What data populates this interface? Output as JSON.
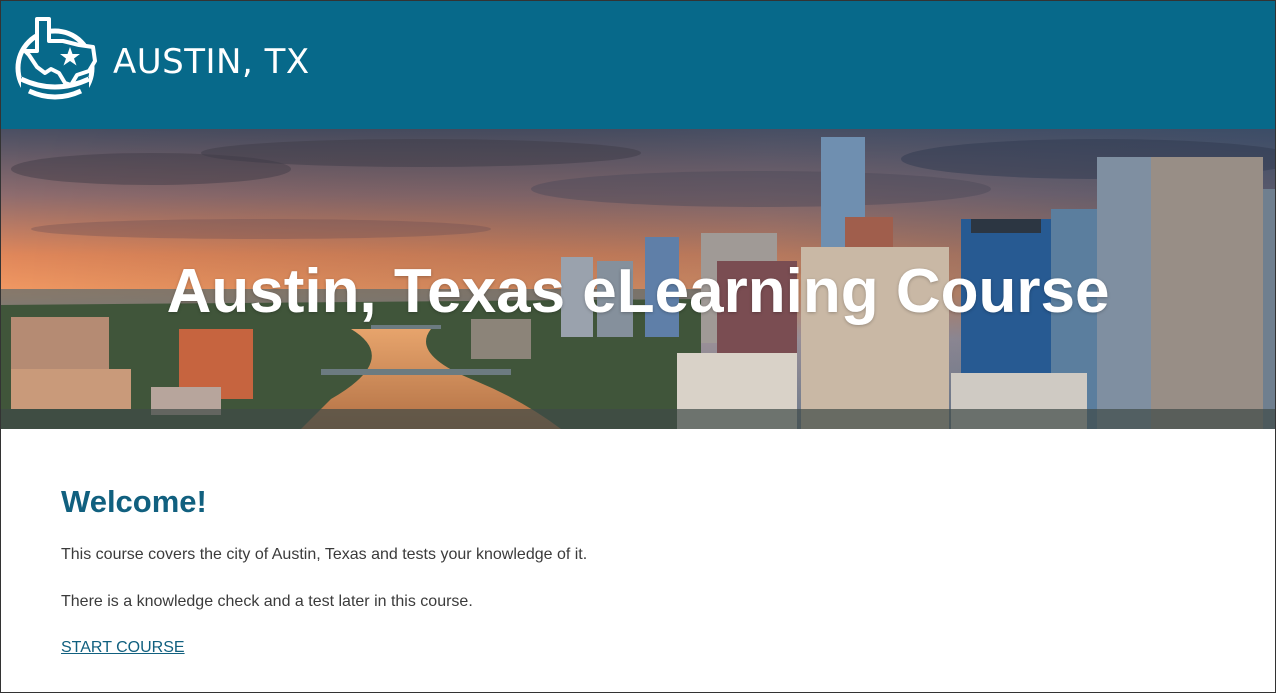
{
  "header": {
    "brand_text": "AUSTIN, TX",
    "logo_icon": "texas-map-star-icon",
    "background_color": "#07698a"
  },
  "hero": {
    "title": "Austin, Texas eLearning Course",
    "image_subject": "austin-skyline-sunset-image"
  },
  "main": {
    "heading": "Welcome!",
    "paragraphs": [
      "This course covers the city of Austin, Texas and tests your knowledge of it.",
      "There is a knowledge check and a test later in this course."
    ],
    "start_link": "START COURSE",
    "accent_color": "#11607f"
  }
}
